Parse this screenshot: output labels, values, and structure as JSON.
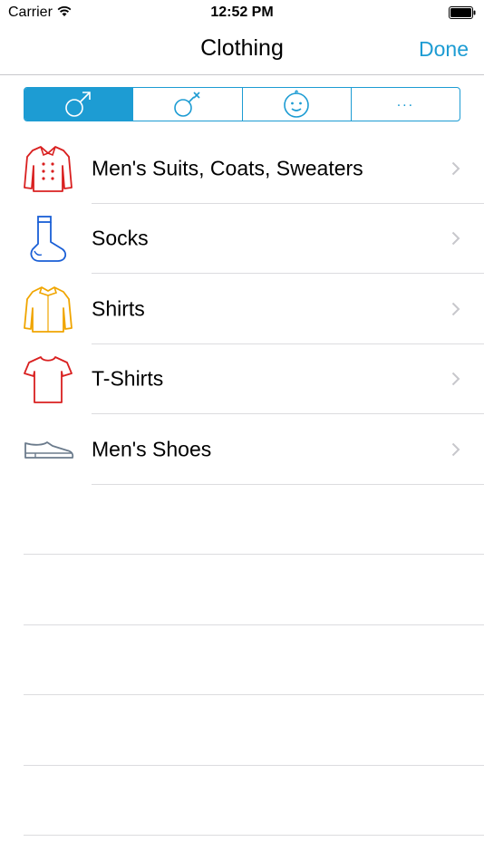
{
  "status_bar": {
    "carrier": "Carrier",
    "time": "12:52 PM"
  },
  "nav": {
    "title": "Clothing",
    "done_label": "Done"
  },
  "segments": [
    {
      "icon": "male-symbol-icon",
      "selected": true
    },
    {
      "icon": "female-symbol-icon",
      "selected": false
    },
    {
      "icon": "baby-face-icon",
      "selected": false
    },
    {
      "label": "...",
      "selected": false
    }
  ],
  "items": [
    {
      "label": "Men's Suits, Coats, Sweaters",
      "icon": "coat-icon",
      "color": "#d92020"
    },
    {
      "label": "Socks",
      "icon": "sock-icon",
      "color": "#1a5fd6"
    },
    {
      "label": "Shirts",
      "icon": "shirt-icon",
      "color": "#f0a500"
    },
    {
      "label": "T-Shirts",
      "icon": "tshirt-icon",
      "color": "#d92020"
    },
    {
      "label": "Men's Shoes",
      "icon": "shoe-icon",
      "color": "#6b7b8c"
    }
  ],
  "colors": {
    "accent": "#1d9cd3",
    "separator": "#dcdcdf",
    "chevron": "#c7c7cc"
  }
}
